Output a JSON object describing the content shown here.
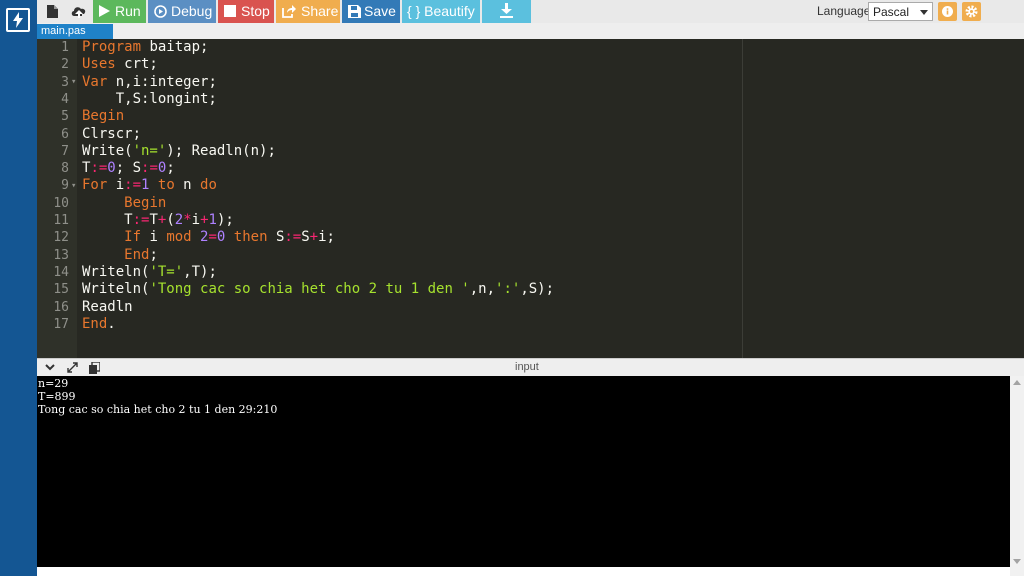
{
  "toolbar": {
    "run_label": "Run",
    "debug_label": "Debug",
    "stop_label": "Stop",
    "share_label": "Share",
    "save_label": "Save",
    "beautify_label": "{ } Beautify",
    "language_label": "Language",
    "language_value": "Pascal"
  },
  "tabs": [
    {
      "label": "main.pas"
    }
  ],
  "editor": {
    "line_numbers": [
      "1",
      "2",
      "3",
      "4",
      "5",
      "6",
      "7",
      "8",
      "9",
      "10",
      "11",
      "12",
      "13",
      "14",
      "15",
      "16",
      "17"
    ]
  },
  "panel": {
    "title": "input"
  },
  "console": {
    "lines": [
      "n=29",
      "T=899",
      "Tong cac so chia het cho 2 tu 1 den 29:210"
    ]
  },
  "colors": {
    "sidebar": "#145693",
    "run": "#5cb85c",
    "debug": "#5b8fc3",
    "stop": "#d9534f",
    "share": "#f0ad4e",
    "save": "#337ab7",
    "beautify": "#5bc0de",
    "editor_bg": "#272822",
    "keyword": "#e8772e",
    "string": "#a6e22e",
    "number": "#ae81ff"
  },
  "icons": [
    "bolt-icon",
    "new-file-icon",
    "cloud-upload-icon",
    "play-icon",
    "debug-icon",
    "stop-icon",
    "share-icon",
    "floppy-disk-icon",
    "download-icon",
    "info-icon",
    "gear-icon",
    "chevron-down-icon",
    "expand-icon",
    "copy-icon"
  ]
}
